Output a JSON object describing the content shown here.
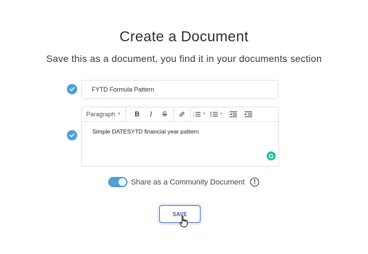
{
  "header": {
    "title": "Create a Document",
    "subtitle": "Save this as a document, you find it in your documents section"
  },
  "form": {
    "name_value": "FYTD Formula Pattern",
    "editor": {
      "toolbar": {
        "paragraph_label": "Paragraph",
        "bold_label": "B",
        "italic_label": "I",
        "strike_label": "S"
      },
      "content": "Simple DATESYTD financial year pattern",
      "assistant_badge": "G"
    },
    "share": {
      "label": "Share as a Community Document",
      "enabled": true,
      "info_glyph": "!"
    },
    "save_label": "SAVE"
  },
  "icons": {
    "valid": "check-circle-icon",
    "link": "link-icon",
    "ordered_list": "ordered-list-icon",
    "bullet_list": "bullet-list-icon",
    "outdent": "outdent-icon",
    "indent": "indent-icon",
    "info": "info-icon",
    "cursor": "hand-pointer-icon"
  },
  "colors": {
    "accent": "#4f9fd8",
    "save_border": "#4a6fc1",
    "grammarly": "#15c39a"
  }
}
